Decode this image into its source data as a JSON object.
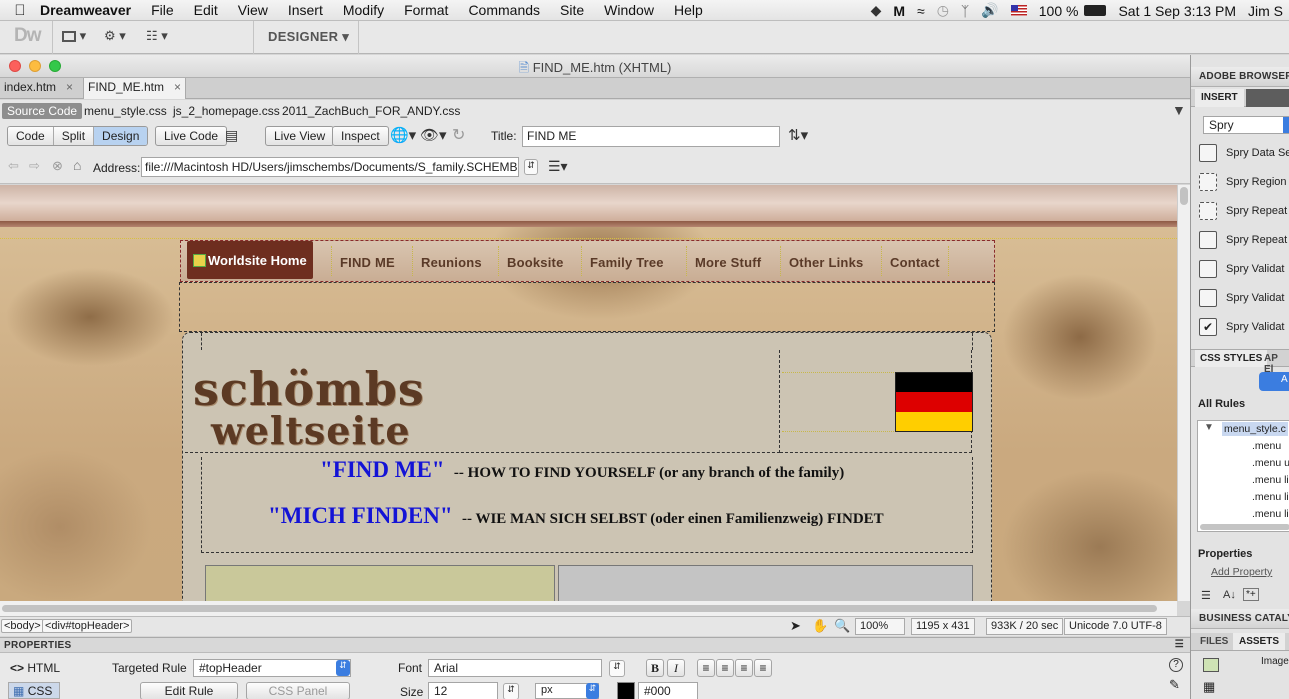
{
  "menubar": {
    "app": "Dreamweaver",
    "menus": [
      "File",
      "Edit",
      "View",
      "Insert",
      "Modify",
      "Format",
      "Commands",
      "Site",
      "Window",
      "Help"
    ],
    "battery": "100 %",
    "datetime": "Sat 1 Sep  3:13 PM",
    "user": "Jim S"
  },
  "toolbar": {
    "logo": "Dw",
    "workspace": "DESIGNER ▾"
  },
  "window": {
    "title": "FIND_ME.htm (XHTML)"
  },
  "doc_tabs": [
    {
      "label": "index.htm"
    },
    {
      "label": "FIND_ME.htm"
    }
  ],
  "related": {
    "source": "Source Code",
    "files": [
      "menu_style.css",
      "js_2_homepage.css",
      "2011_ZachBuch_FOR_ANDY.css"
    ]
  },
  "doctoolbar": {
    "code": "Code",
    "split": "Split",
    "design": "Design",
    "live_code": "Live Code",
    "live_view": "Live View",
    "inspect": "Inspect",
    "title_label": "Title:",
    "title_value": "FIND ME"
  },
  "address": {
    "label": "Address:",
    "value": "file:///Macintosh HD/Users/jimschembs/Documents/S_family.SCHEMBS.com"
  },
  "page": {
    "nav": [
      "Worldsite Home",
      "FIND ME",
      "Reunions",
      "Booksite",
      "Family Tree",
      "More Stuff",
      "Other Links",
      "Contact"
    ],
    "logo_line1": "schömbs",
    "logo_line2": "weltseite",
    "find1_title": "\"FIND ME\"",
    "find1_sub": "-- HOW TO FIND YOURSELF (or any branch of the family)",
    "find2_title": "\"MICH FINDEN\"",
    "find2_sub": "-- WIE MAN SICH SELBST (oder einen Familienzweig) FINDET",
    "flag_colors": [
      "#000000",
      "#dd0000",
      "#ffce00"
    ]
  },
  "status": {
    "tag1": "<body>",
    "tag2": "<div#topHeader>",
    "zoom": "100%",
    "dims": "1195 x 431",
    "size": "933K / 20 sec",
    "encoding": "Unicode 7.0 UTF-8"
  },
  "properties": {
    "header": "PROPERTIES",
    "html": "HTML",
    "css": "CSS",
    "targeted_rule_label": "Targeted Rule",
    "targeted_rule": "#topHeader",
    "edit_rule": "Edit Rule",
    "css_panel": "CSS Panel",
    "font_label": "Font",
    "font": "Arial",
    "size_label": "Size",
    "size": "12",
    "unit": "px",
    "color": "#000"
  },
  "rightpanel": {
    "browserlab": "ADOBE BROWSERLAB",
    "insert": "INSERT",
    "category": "Spry",
    "items": [
      "Spry Data Se",
      "Spry Region",
      "Spry Repeat",
      "Spry Repeat",
      "Spry Validat",
      "Spry Validat",
      "Spry Validat"
    ],
    "css_styles": "CSS STYLES",
    "ap": "AP El",
    "all_rules": "All Rules",
    "rules": [
      "menu_style.c",
      ".menu",
      ".menu u",
      ".menu li",
      ".menu li",
      ".menu li"
    ],
    "properties": "Properties",
    "add_property": "Add Property",
    "business": "BUSINESS CATALYST",
    "files": "FILES",
    "assets": "ASSETS",
    "images": "Images"
  }
}
